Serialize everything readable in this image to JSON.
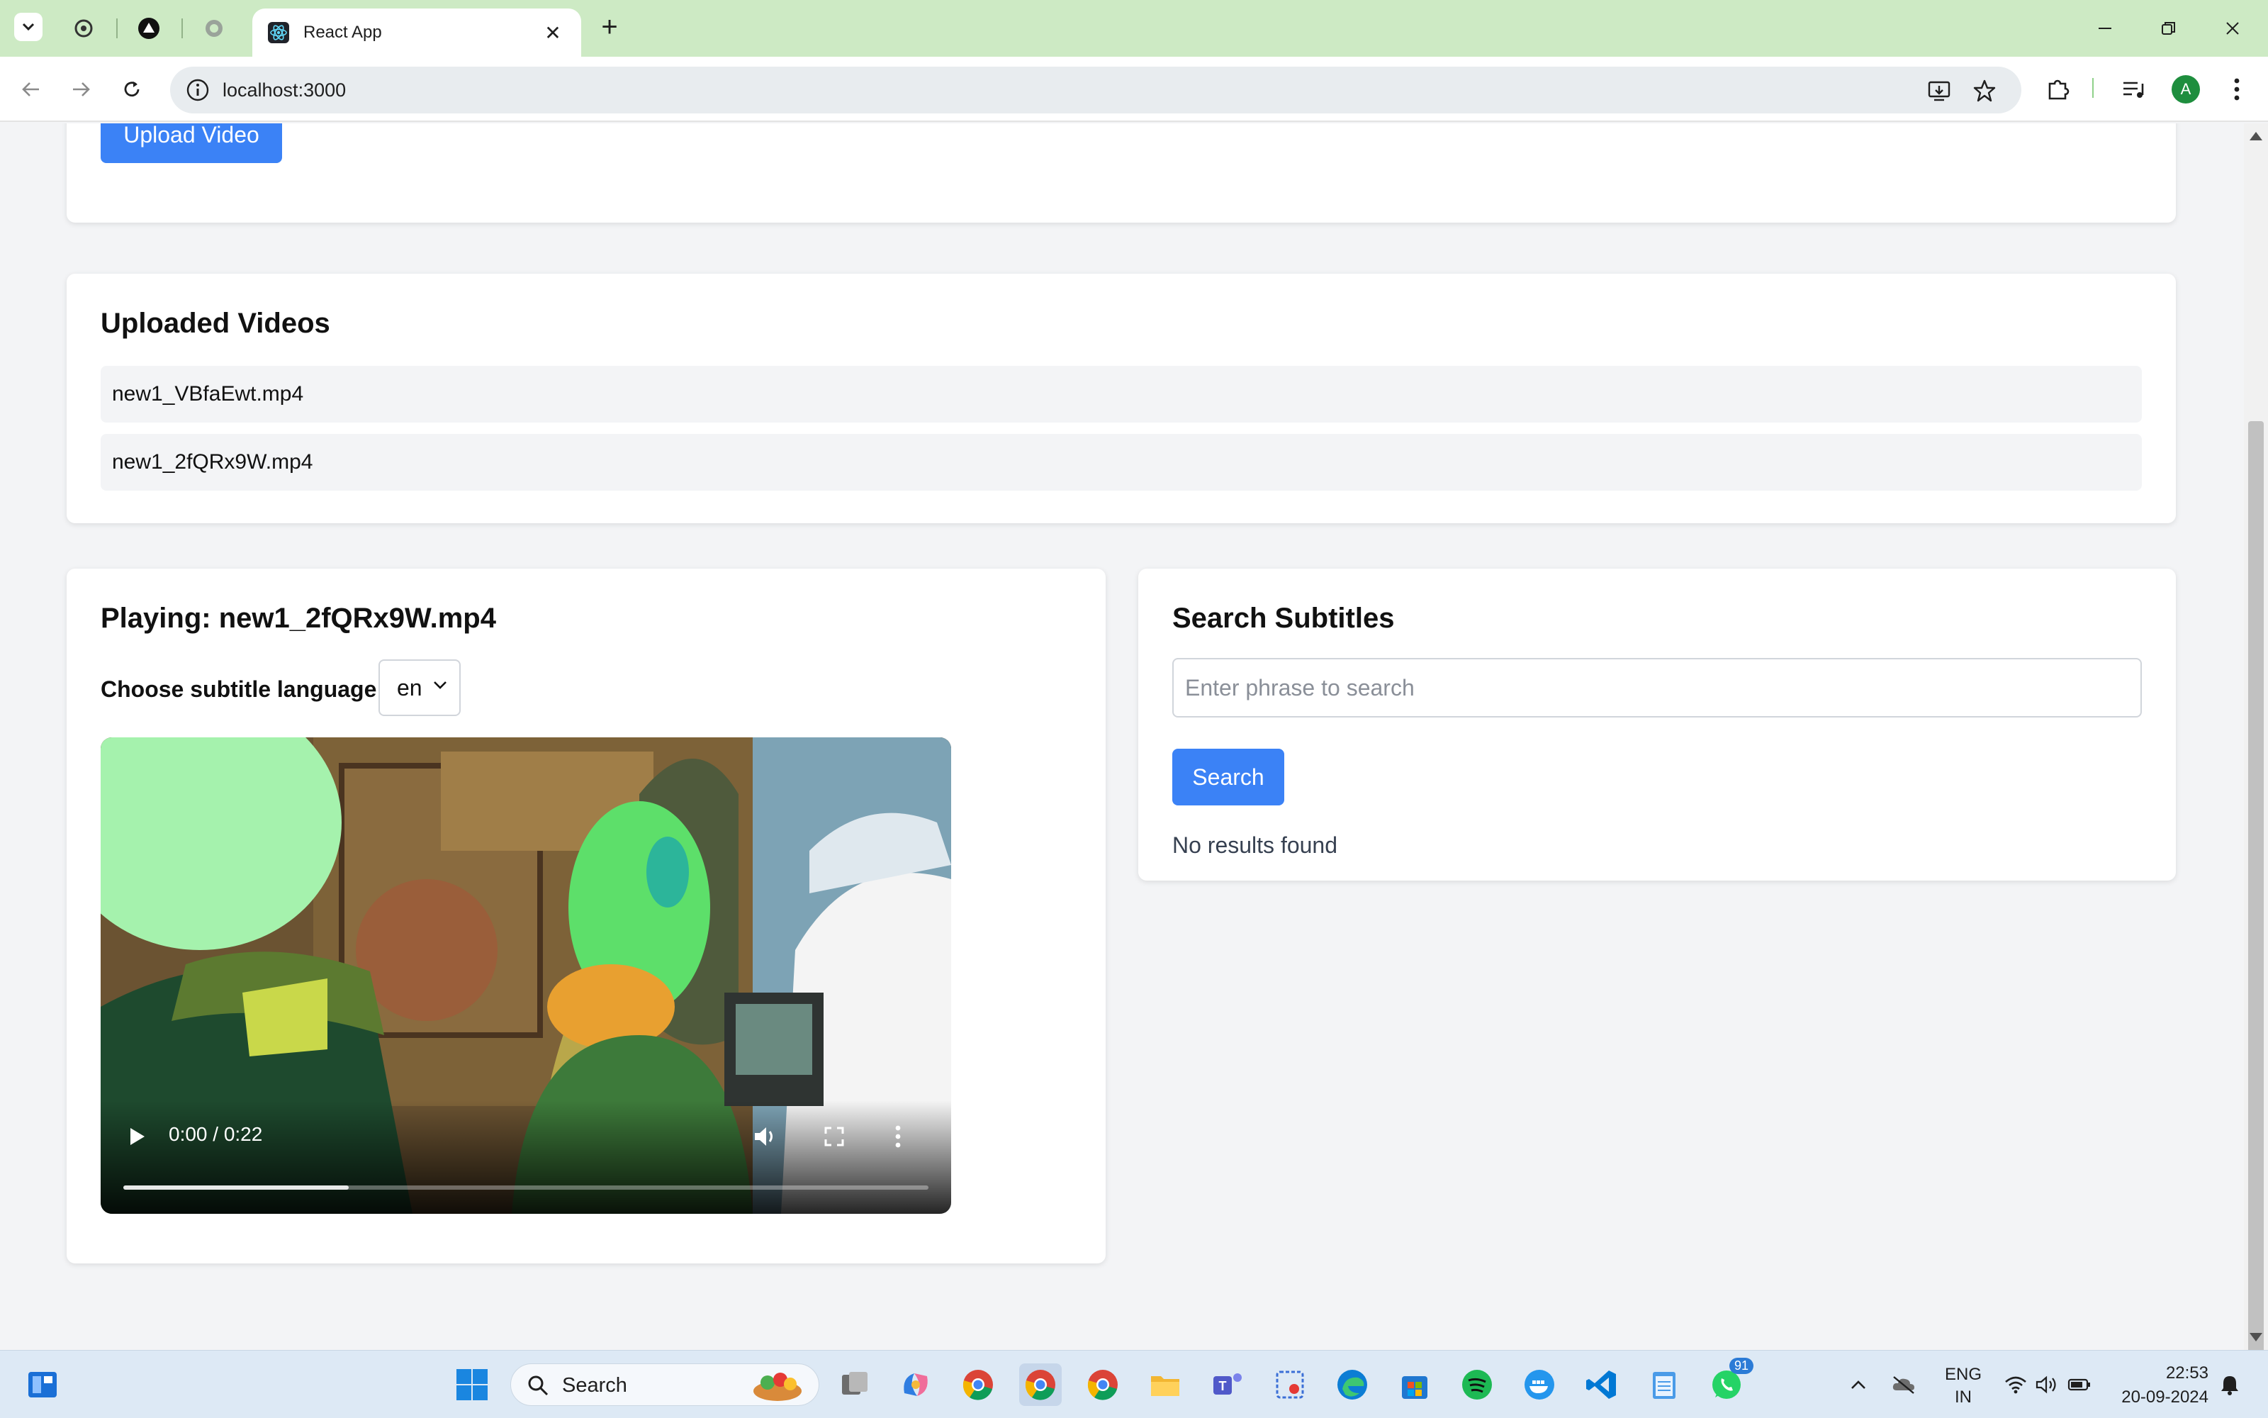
{
  "browser": {
    "active_tab_title": "React App",
    "url": "localhost:3000",
    "profile_initial": "A"
  },
  "upload": {
    "button_label": "Upload Video"
  },
  "uploaded_videos": {
    "heading": "Uploaded Videos",
    "items": [
      "new1_VBfaEwt.mp4",
      "new1_2fQRx9W.mp4"
    ]
  },
  "player": {
    "heading": "Playing: new1_2fQRx9W.mp4",
    "language_label": "Choose subtitle language:",
    "language_value": "en",
    "time": "0:00 / 0:22",
    "buffered_fraction": 0.28
  },
  "search": {
    "heading": "Search Subtitles",
    "placeholder": "Enter phrase to search",
    "button_label": "Search",
    "result_text": "No results found"
  },
  "taskbar": {
    "search_label": "Search",
    "lang_line1": "ENG",
    "lang_line2": "IN",
    "time": "22:53",
    "date": "20-09-2024",
    "whatsapp_badge": "91"
  },
  "colors": {
    "primary": "#3b82f6",
    "tabbar": "#cdeac4",
    "page_bg": "#f3f4f6"
  }
}
